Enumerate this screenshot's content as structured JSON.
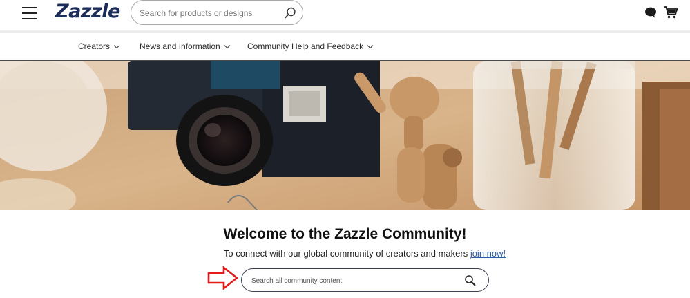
{
  "header": {
    "logo_text": "Zazzle",
    "search_placeholder": "Search for products or designs",
    "icons": [
      "hamburger-menu-icon",
      "search-icon",
      "chat-icon",
      "cart-icon"
    ]
  },
  "nav": {
    "items": [
      {
        "label": "Creators"
      },
      {
        "label": "News and Information"
      },
      {
        "label": "Community Help and Feedback"
      }
    ]
  },
  "hero": {
    "image_description": "Desk scene with camera, wooden art mannequin and glass jar of pencils"
  },
  "welcome": {
    "title": "Welcome to the Zazzle Community!",
    "subtitle_prefix": "To connect with our global community of creators and makers ",
    "join_link": "join now!",
    "search_placeholder": "Search all community content"
  },
  "colors": {
    "logo": "#1d2d5a",
    "link": "#2b5cab",
    "arrow": "#e01b1b"
  }
}
